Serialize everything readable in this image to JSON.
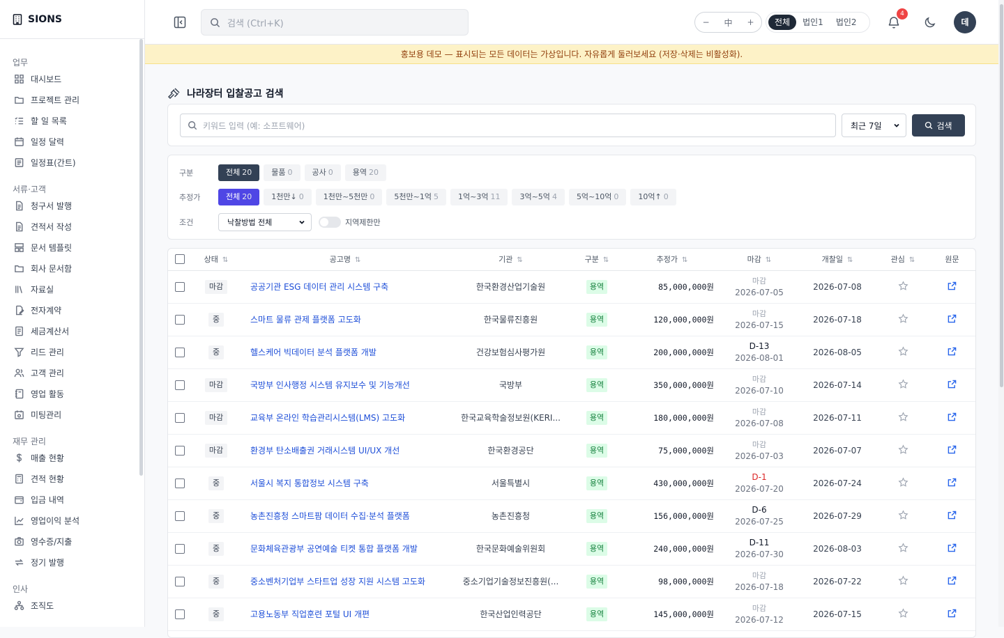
{
  "app": {
    "name": "SIONS"
  },
  "sidebar": {
    "sections": [
      {
        "title": "업무",
        "items": [
          {
            "label": "대시보드",
            "icon": "grid-icon"
          },
          {
            "label": "프로젝트 관리",
            "icon": "folder-icon"
          },
          {
            "label": "할 일 목록",
            "icon": "list-check-icon"
          },
          {
            "label": "일정 달력",
            "icon": "calendar-icon"
          },
          {
            "label": "일정표(간트)",
            "icon": "gantt-icon"
          }
        ]
      },
      {
        "title": "서류·고객",
        "items": [
          {
            "label": "청구서 발행",
            "icon": "document-icon"
          },
          {
            "label": "견적서 작성",
            "icon": "document-icon"
          },
          {
            "label": "문서 템플릿",
            "icon": "template-icon"
          },
          {
            "label": "회사 문서함",
            "icon": "folder-icon"
          },
          {
            "label": "자료실",
            "icon": "library-icon"
          },
          {
            "label": "전자계약",
            "icon": "contract-icon"
          },
          {
            "label": "세금계산서",
            "icon": "receipt-icon"
          },
          {
            "label": "리드 관리",
            "icon": "funnel-icon"
          },
          {
            "label": "고객 관리",
            "icon": "users-icon"
          },
          {
            "label": "영업 활동",
            "icon": "notebook-icon"
          },
          {
            "label": "미팅관리",
            "icon": "meeting-icon"
          }
        ]
      },
      {
        "title": "재무 관리",
        "items": [
          {
            "label": "매출 현황",
            "icon": "dollar-icon"
          },
          {
            "label": "견적 현황",
            "icon": "calculator-icon"
          },
          {
            "label": "입금 내역",
            "icon": "wallet-icon"
          },
          {
            "label": "영업이익 분석",
            "icon": "chart-line-icon"
          },
          {
            "label": "영수증/지출",
            "icon": "camera-icon"
          },
          {
            "label": "정기 발행",
            "icon": "repeat-icon"
          }
        ]
      },
      {
        "title": "인사",
        "items": [
          {
            "label": "조직도",
            "icon": "org-chart-icon"
          }
        ]
      }
    ]
  },
  "topbar": {
    "search_placeholder": "검색 (Ctrl+K)",
    "zoom": {
      "minus": "−",
      "label": "中",
      "plus": "+"
    },
    "corp_tabs": [
      "전체",
      "법인1",
      "법인2"
    ],
    "corp_active": "전체",
    "notif_count": "4",
    "avatar": "데"
  },
  "banner": "홍보용 데모 — 표시되는 모든 데이터는 가상입니다. 자유롭게 둘러보세요 (저장·삭제는 비활성화).",
  "page": {
    "title": "나라장터 입찰공고 검색"
  },
  "search": {
    "placeholder": "키워드 입력 (예: 소프트웨어)",
    "period": "최근 7일",
    "button": "검색"
  },
  "filters": {
    "category_label": "구분",
    "categories": [
      {
        "label": "전체",
        "count": "20"
      },
      {
        "label": "물품",
        "count": "0"
      },
      {
        "label": "공사",
        "count": "0"
      },
      {
        "label": "용역",
        "count": "20"
      }
    ],
    "price_label": "추정가",
    "prices": [
      {
        "label": "전체",
        "count": "20"
      },
      {
        "label": "1천만↓",
        "count": "0"
      },
      {
        "label": "1천만~5천만",
        "count": "0"
      },
      {
        "label": "5천만~1억",
        "count": "5"
      },
      {
        "label": "1억~3억",
        "count": "11"
      },
      {
        "label": "3억~5억",
        "count": "4"
      },
      {
        "label": "5억~10억",
        "count": "0"
      },
      {
        "label": "10억↑",
        "count": "0"
      }
    ],
    "condition_label": "조건",
    "method": "낙찰방법 전체",
    "region_label": "지역제한만"
  },
  "table": {
    "headers": [
      "상태",
      "공고명",
      "기관",
      "구분",
      "추정가",
      "마감",
      "개찰일",
      "관심",
      "원문"
    ],
    "rows": [
      {
        "status": "마감",
        "title": "공공기관 ESG 데이터 관리 시스템 구축",
        "org": "한국환경산업기술원",
        "cat": "용역",
        "price": "85,000,000원",
        "deadline_top": "마감",
        "deadline_kind": "closed",
        "deadline": "2026-07-05",
        "open_date": "2026-07-08"
      },
      {
        "status": "중",
        "title": "스마트 물류 관제 플랫폼 고도화",
        "org": "한국물류진흥원",
        "cat": "용역",
        "price": "120,000,000원",
        "deadline_top": "마감",
        "deadline_kind": "closed",
        "deadline": "2026-07-15",
        "open_date": "2026-07-18"
      },
      {
        "status": "중",
        "title": "헬스케어 빅데이터 분석 플랫폼 개발",
        "org": "건강보험심사평가원",
        "cat": "용역",
        "price": "200,000,000원",
        "deadline_top": "D-13",
        "deadline_kind": "normal",
        "deadline": "2026-08-01",
        "open_date": "2026-08-05"
      },
      {
        "status": "마감",
        "title": "국방부 인사행정 시스템 유지보수 및 기능개선",
        "org": "국방부",
        "cat": "용역",
        "price": "350,000,000원",
        "deadline_top": "마감",
        "deadline_kind": "closed",
        "deadline": "2026-07-10",
        "open_date": "2026-07-14"
      },
      {
        "status": "마감",
        "title": "교육부 온라인 학습관리시스템(LMS) 고도화",
        "org": "한국교육학술정보원(KERI...",
        "cat": "용역",
        "price": "180,000,000원",
        "deadline_top": "마감",
        "deadline_kind": "closed",
        "deadline": "2026-07-08",
        "open_date": "2026-07-11"
      },
      {
        "status": "마감",
        "title": "환경부 탄소배출권 거래시스템 UI/UX 개선",
        "org": "한국환경공단",
        "cat": "용역",
        "price": "75,000,000원",
        "deadline_top": "마감",
        "deadline_kind": "closed",
        "deadline": "2026-07-03",
        "open_date": "2026-07-07"
      },
      {
        "status": "중",
        "title": "서울시 복지 통합정보 시스템 구축",
        "org": "서울특별시",
        "cat": "용역",
        "price": "430,000,000원",
        "deadline_top": "D-1",
        "deadline_kind": "urgent",
        "deadline": "2026-07-20",
        "open_date": "2026-07-24"
      },
      {
        "status": "중",
        "title": "농촌진흥청 스마트팜 데이터 수집·분석 플랫폼",
        "org": "농촌진흥청",
        "cat": "용역",
        "price": "156,000,000원",
        "deadline_top": "D-6",
        "deadline_kind": "normal",
        "deadline": "2026-07-25",
        "open_date": "2026-07-29"
      },
      {
        "status": "중",
        "title": "문화체육관광부 공연예술 티켓 통합 플랫폼 개발",
        "org": "한국문화예술위원회",
        "cat": "용역",
        "price": "240,000,000원",
        "deadline_top": "D-11",
        "deadline_kind": "normal",
        "deadline": "2026-07-30",
        "open_date": "2026-08-03"
      },
      {
        "status": "중",
        "title": "중소벤처기업부 스타트업 성장 지원 시스템 고도화",
        "org": "중소기업기술정보진흥원(...",
        "cat": "용역",
        "price": "98,000,000원",
        "deadline_top": "마감",
        "deadline_kind": "closed",
        "deadline": "2026-07-18",
        "open_date": "2026-07-22"
      },
      {
        "status": "중",
        "title": "고용노동부 직업훈련 포털 UI 개편",
        "org": "한국산업인력공단",
        "cat": "용역",
        "price": "145,000,000원",
        "deadline_top": "마감",
        "deadline_kind": "closed",
        "deadline": "2026-07-12",
        "open_date": "2026-07-15"
      }
    ]
  }
}
